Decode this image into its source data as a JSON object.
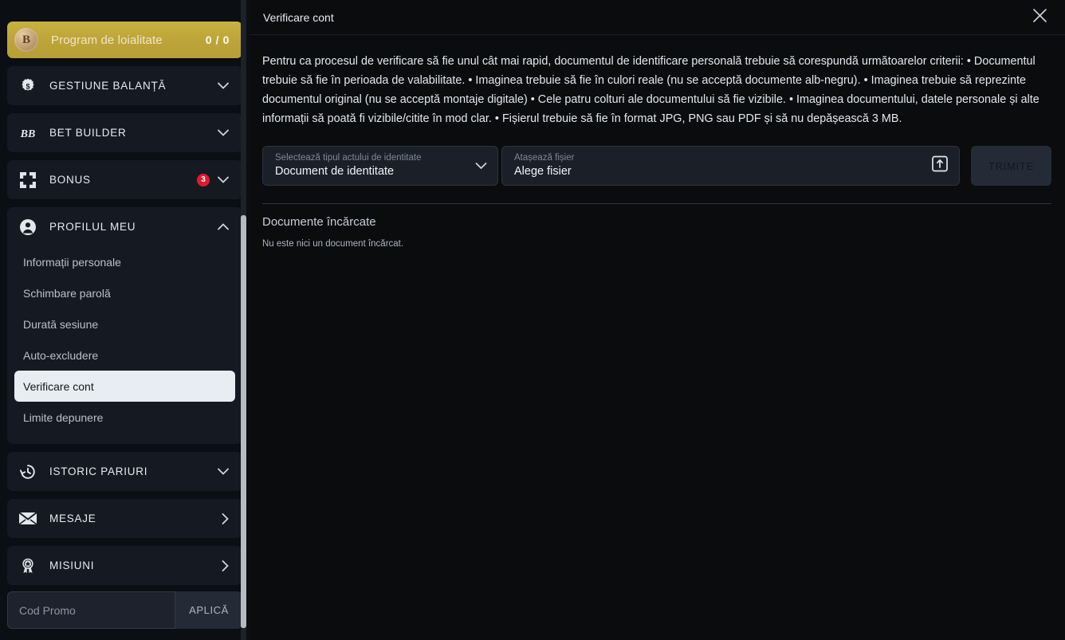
{
  "sidebar": {
    "loyalty": {
      "medal_letter": "B",
      "label": "Program de loialitate",
      "count": "0 / 0"
    },
    "sections": [
      {
        "label": "GESTIUNE BALANȚĂ",
        "icon": "dollar-gear-icon",
        "chevron": "⌄",
        "badge": null
      },
      {
        "label": "BET BUILDER",
        "icon": "bet-builder-icon",
        "chevron": "⌄",
        "badge": null
      },
      {
        "label": "BONUS",
        "icon": "bonus-gift-icon",
        "chevron": "⌄",
        "badge": "3"
      }
    ],
    "profile": {
      "label": "PROFILUL MEU",
      "icon": "user-circle-icon",
      "chevron": "⌃",
      "items": [
        {
          "label": "Informații personale",
          "active": false
        },
        {
          "label": "Schimbare parolă",
          "active": false
        },
        {
          "label": "Durată sesiune",
          "active": false
        },
        {
          "label": "Auto-excludere",
          "active": false
        },
        {
          "label": "Verificare cont",
          "active": true
        },
        {
          "label": "Limite depunere",
          "active": false
        }
      ]
    },
    "sections_bottom": [
      {
        "label": "ISTORIC PARIURI",
        "icon": "history-clock-icon",
        "chevron": "⌄",
        "badge": null
      },
      {
        "label": "MESAJE",
        "icon": "envelope-icon",
        "chevron": "›",
        "badge": null
      },
      {
        "label": "MISIUNI",
        "icon": "medal-star-icon",
        "chevron": "›",
        "badge": null
      }
    ],
    "promo": {
      "placeholder": "Cod Promo",
      "value": "",
      "button_label": "APLICĂ"
    }
  },
  "main": {
    "title": "Verificare cont",
    "close_icon": "close-icon",
    "intro": "Pentru ca procesul de verificare să fie unul cât mai rapid, documentul de identificare personală trebuie să corespundă următoarelor criterii: • Documentul trebuie să fie în perioada de valabilitate. • Imaginea trebuie să fie în culori reale (nu se acceptă documente alb-negru). • Imaginea trebuie să reprezinte documentul original (nu se acceptă montaje digitale) • Cele patru colturi ale documentului să fie vizibile. • Imaginea documentului, datele personale și alte informații să poată fi vizibile/citite în mod clar. • Fișierul trebuie să fie în format JPG, PNG sau PDF și să nu depășească 3 MB.",
    "doc_type": {
      "label": "Selectează tipul actului de identitate",
      "value": "Document de identitate",
      "chevron": "⌄"
    },
    "file_field": {
      "label": "Atașează fișier",
      "value": "Alege fisier",
      "icon": "upload-box-icon"
    },
    "submit_label": "TRIMITE",
    "uploaded_title": "Documente încărcate",
    "uploaded_empty": "Nu este nici un document încărcat."
  },
  "colors": {
    "accent_gold": "#bda53a",
    "badge_red": "#e01b2e",
    "panel": "#151a22",
    "background": "#0a0c0e",
    "active_item_bg": "#e8edf1"
  }
}
